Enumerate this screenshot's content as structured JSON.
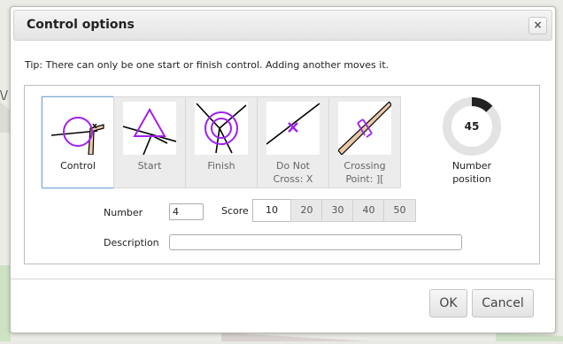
{
  "dialog": {
    "title": "Control options",
    "close_glyph": "×",
    "tip": "Tip: There can only be one start or finish control. Adding another moves it."
  },
  "control_types": [
    {
      "label": "Control",
      "icon": "control-circle-icon",
      "selected": true
    },
    {
      "label": "Start",
      "icon": "start-triangle-icon",
      "selected": false
    },
    {
      "label": "Finish",
      "icon": "finish-double-circle-icon",
      "selected": false
    },
    {
      "label": "Do Not Cross: X",
      "icon": "do-not-cross-icon",
      "selected": false
    },
    {
      "label": "Crossing Point: ][",
      "icon": "crossing-point-icon",
      "selected": false
    }
  ],
  "number_position": {
    "value": "45",
    "label": "Number position",
    "fraction": 0.125
  },
  "form": {
    "number_label": "Number",
    "number_value": "4",
    "score_label": "Score",
    "score_options": [
      "10",
      "20",
      "30",
      "40",
      "50"
    ],
    "score_selected": "10",
    "description_label": "Description",
    "description_value": ""
  },
  "buttons": {
    "ok": "OK",
    "cancel": "Cancel"
  },
  "colors": {
    "control_purple": "#a020f0",
    "accent_blue": "#7ea8d3",
    "gauge_dark": "#222222",
    "gauge_light": "#e3e3e3"
  }
}
